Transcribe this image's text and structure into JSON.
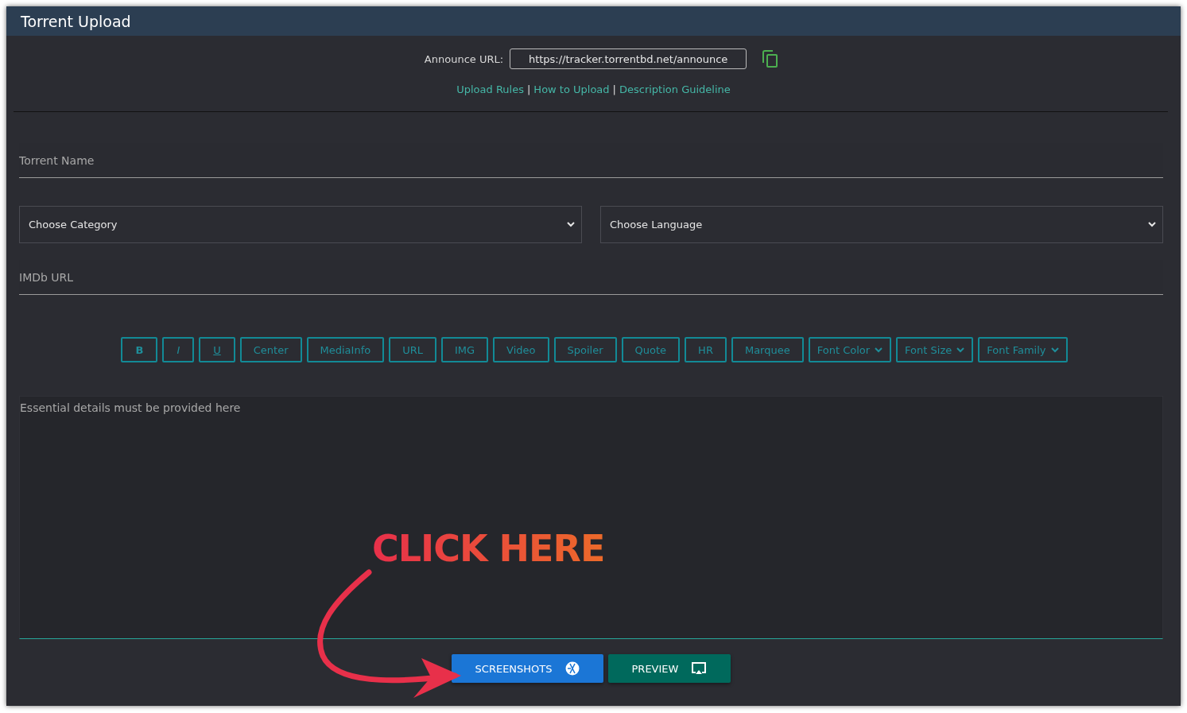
{
  "window": {
    "title": "Torrent Upload"
  },
  "announce": {
    "label": "Announce URL:",
    "value": "https://tracker.torrentbd.net/announce"
  },
  "links": [
    {
      "label": "Upload Rules"
    },
    {
      "label": "How to Upload"
    },
    {
      "label": "Description Guideline"
    }
  ],
  "link_separator": "|",
  "torrent_name": {
    "placeholder": "Torrent Name"
  },
  "category": {
    "value": "Choose Category"
  },
  "language": {
    "value": "Choose Language"
  },
  "imdb": {
    "placeholder": "IMDb URL"
  },
  "toolbar": [
    {
      "kind": "bold",
      "label": "B"
    },
    {
      "kind": "italic",
      "label": "I"
    },
    {
      "kind": "underline",
      "label": "U"
    },
    {
      "kind": "button",
      "label": "Center"
    },
    {
      "kind": "button",
      "label": "MediaInfo"
    },
    {
      "kind": "button",
      "label": "URL"
    },
    {
      "kind": "button",
      "label": "IMG"
    },
    {
      "kind": "button",
      "label": "Video"
    },
    {
      "kind": "button",
      "label": "Spoiler"
    },
    {
      "kind": "button",
      "label": "Quote"
    },
    {
      "kind": "button",
      "label": "HR"
    },
    {
      "kind": "button",
      "label": "Marquee"
    },
    {
      "kind": "select",
      "label": "Font Color"
    },
    {
      "kind": "select",
      "label": "Font Size"
    },
    {
      "kind": "select",
      "label": "Font Family"
    }
  ],
  "description": {
    "placeholder": "Essential details must be provided here"
  },
  "buttons": [
    {
      "label": "SCREENSHOTS",
      "kind": "screenshots"
    },
    {
      "label": "PREVIEW",
      "kind": "preview"
    }
  ],
  "annotation": {
    "text": "CLICK HERE"
  }
}
